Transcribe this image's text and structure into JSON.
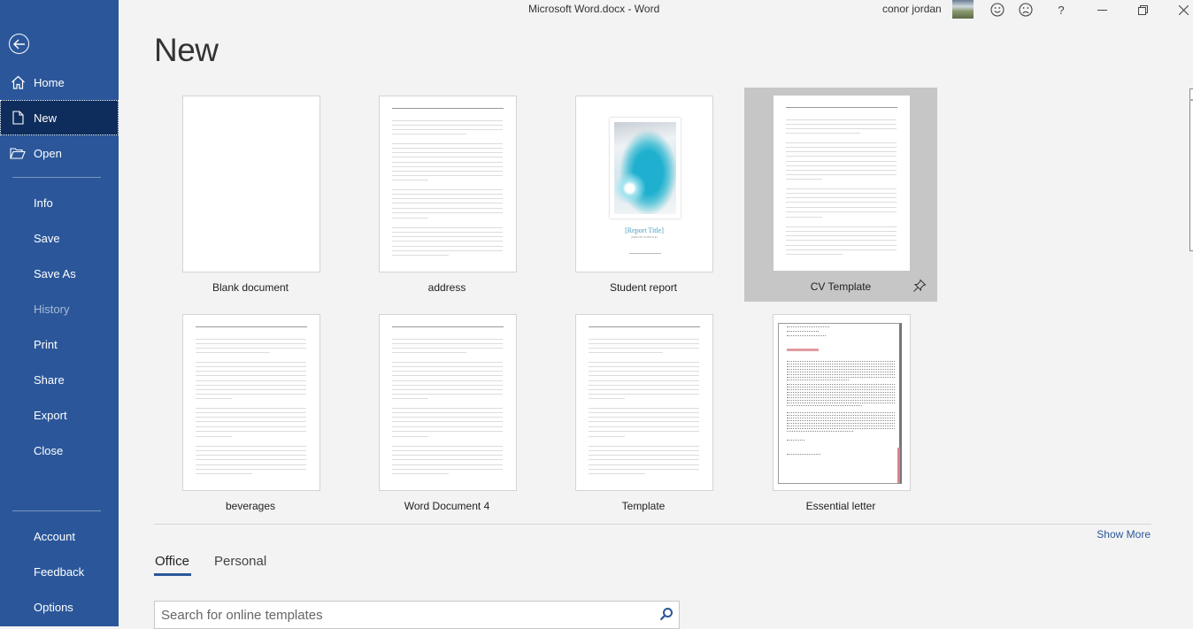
{
  "window": {
    "title": "Microsoft Word.docx  -  Word",
    "user_name": "conor jordan",
    "buttons": {
      "smile": "smile-icon",
      "frown": "frown-icon",
      "help": "?",
      "minimize": "minimize-icon",
      "restore": "restore-icon",
      "close": "close-icon"
    }
  },
  "sidebar": {
    "back": "back-arrow-icon",
    "items": [
      {
        "label": "Home",
        "icon": "home-icon"
      },
      {
        "label": "New",
        "icon": "new-document-icon",
        "active": true
      },
      {
        "label": "Open",
        "icon": "open-folder-icon"
      },
      {
        "label": "Info"
      },
      {
        "label": "Save"
      },
      {
        "label": "Save As"
      },
      {
        "label": "History",
        "disabled": true
      },
      {
        "label": "Print"
      },
      {
        "label": "Share"
      },
      {
        "label": "Export"
      },
      {
        "label": "Close"
      },
      {
        "label": "Account"
      },
      {
        "label": "Feedback"
      },
      {
        "label": "Options"
      }
    ]
  },
  "main": {
    "title": "New",
    "templates": [
      {
        "label": "Blank document",
        "type": "blank"
      },
      {
        "label": "address",
        "type": "lines"
      },
      {
        "label": "Student report",
        "type": "report",
        "report_title": "[Report Title]",
        "report_subtitle": "[REPORT SUBTITLE]"
      },
      {
        "label": "CV Template",
        "type": "lines",
        "selected": true,
        "pinnable": true
      },
      {
        "label": "beverages",
        "type": "lines"
      },
      {
        "label": "Word Document 4",
        "type": "lines"
      },
      {
        "label": "Template",
        "type": "lines"
      },
      {
        "label": "Essential letter",
        "type": "letter"
      }
    ],
    "show_more": "Show More",
    "tabs": [
      {
        "label": "Office",
        "active": true
      },
      {
        "label": "Personal"
      }
    ],
    "search": {
      "placeholder": "Search for online templates",
      "value": ""
    }
  },
  "colors": {
    "accent": "#2b579a",
    "sidebar_active": "#0e2d5c",
    "selected_tile": "#c6c6c6",
    "report_title": "#4a9fbf",
    "letter_accent": "#d9828a"
  }
}
